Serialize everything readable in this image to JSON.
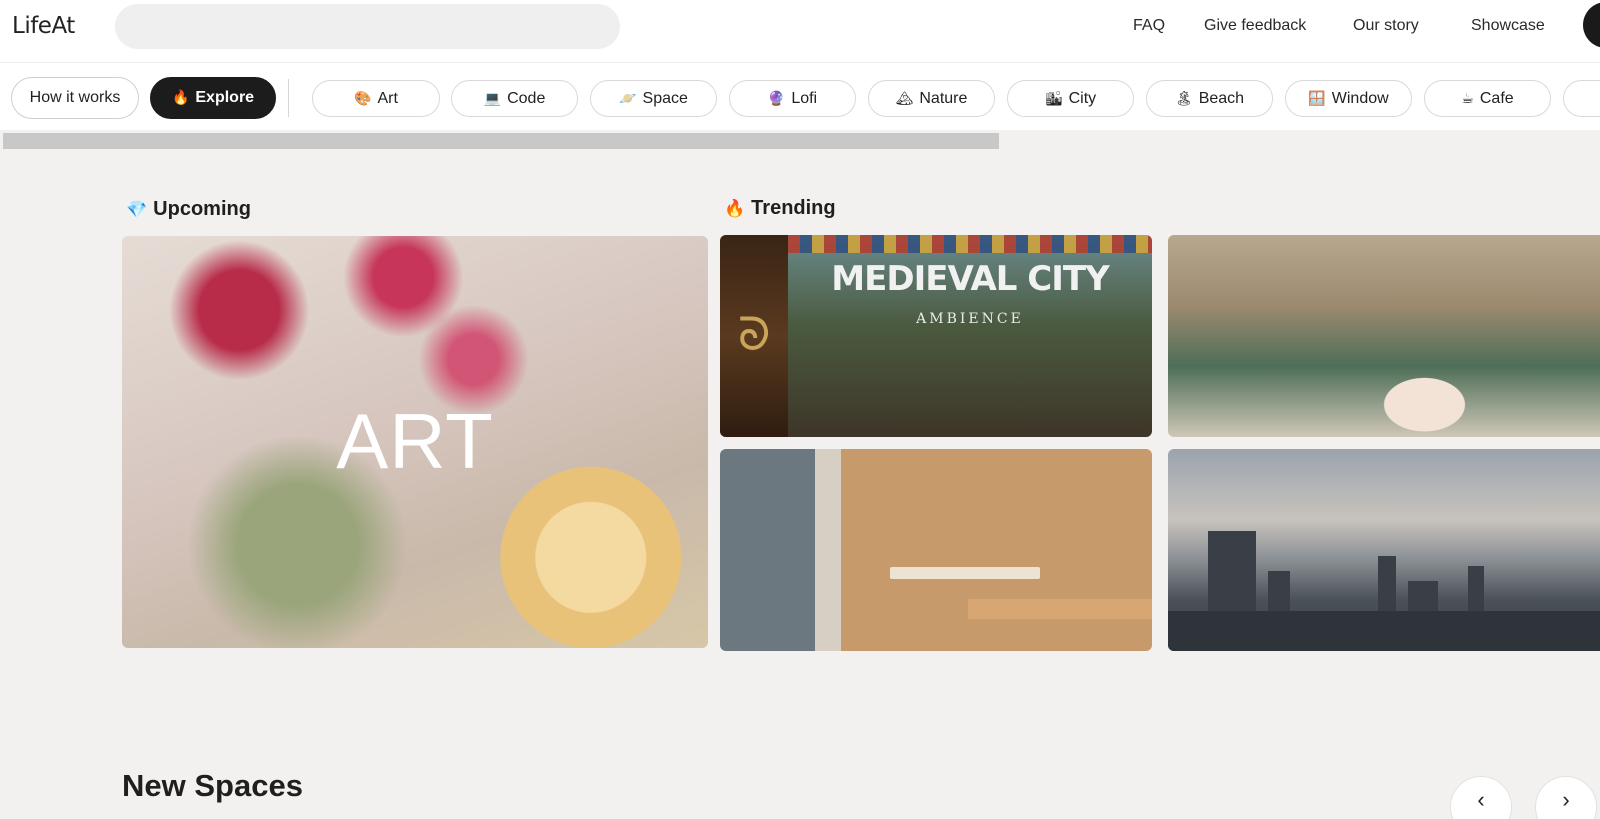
{
  "header": {
    "logo": "LifeAt",
    "search_placeholder": "",
    "links": [
      "FAQ",
      "Give feedback",
      "Our story",
      "Showcase"
    ]
  },
  "tabs": {
    "how_it_works": "How it works",
    "explore": "Explore",
    "explore_icon": "fire-icon"
  },
  "categories": [
    {
      "label": "Art",
      "icon": "palette-icon",
      "glyph": "🎨"
    },
    {
      "label": "Code",
      "icon": "laptop-icon",
      "glyph": "💻"
    },
    {
      "label": "Space",
      "icon": "planet-icon",
      "glyph": "🪐"
    },
    {
      "label": "Lofi",
      "icon": "crystal-ball-icon",
      "glyph": "🔮"
    },
    {
      "label": "Nature",
      "icon": "mountain-icon",
      "glyph": "🏔"
    },
    {
      "label": "City",
      "icon": "cityscape-icon",
      "glyph": "🏙"
    },
    {
      "label": "Beach",
      "icon": "beach-icon",
      "glyph": "🏝"
    },
    {
      "label": "Window",
      "icon": "window-icon",
      "glyph": "🪟"
    },
    {
      "label": "Cafe",
      "icon": "coffee-icon",
      "glyph": "☕"
    }
  ],
  "upcoming": {
    "heading": "Upcoming",
    "icon": "gem-icon",
    "card_title": "ART"
  },
  "trending": {
    "heading": "Trending",
    "icon": "fire-icon",
    "cards": [
      {
        "title": "MEDIEVAL CITY",
        "subtitle": "AMBIENCE"
      },
      {
        "title": ""
      },
      {
        "title": ""
      },
      {
        "title": ""
      }
    ]
  },
  "new_spaces": {
    "heading": "New Spaces",
    "prev": "‹",
    "next": "›"
  },
  "colors": {
    "background": "#f2f1ef",
    "pill_active": "#1c1c1c"
  }
}
